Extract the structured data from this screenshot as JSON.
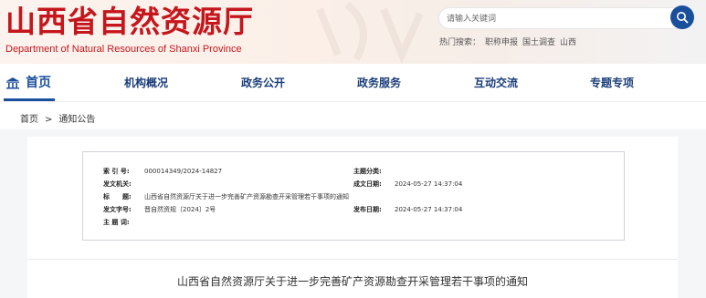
{
  "header": {
    "logo_cn": "山西省自然资源厅",
    "logo_en": "Department of Natural Resources of Shanxi Province",
    "search_placeholder": "请输入关键词",
    "hot_label": "热门搜索：",
    "hot_items": [
      "职称申报",
      "国土调查",
      "山西"
    ]
  },
  "nav": {
    "items": [
      "首页",
      "机构概况",
      "政务公开",
      "政务服务",
      "互动交流",
      "专题专项"
    ]
  },
  "breadcrumb": {
    "home": "首页",
    "separator": ">",
    "current": "通知公告"
  },
  "meta": {
    "index_label": "索 引 号:",
    "index_value": "000014349/2024-14827",
    "topic_label": "主题分类:",
    "topic_value": "",
    "org_label": "发文机关:",
    "org_value": "",
    "date_label": "成文日期:",
    "date_value": "2024-05-27 14:37:04",
    "title_label": "标　　题:",
    "title_value": "山西省自然资源厅关于进一步完善矿产资源勘查开采管理若干事项的通知",
    "docno_label": "发文字号:",
    "docno_value": "晋自然资规〔2024〕2号",
    "pub_label": "发布日期:",
    "pub_value": "2024-05-27 14:37:04",
    "keywords_label": "主 题 词:",
    "keywords_value": ""
  },
  "document": {
    "title": "山西省自然资源厅关于进一步完善矿产资源勘查开采管理若干事项的通知"
  },
  "colors": {
    "brand_red": "#c4161c",
    "brand_blue": "#1a4f9c"
  }
}
